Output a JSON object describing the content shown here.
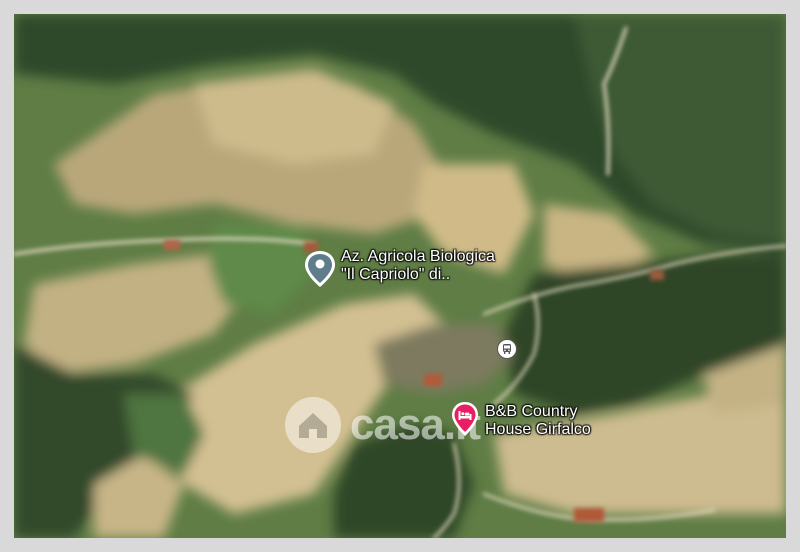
{
  "map": {
    "view": "satellite-3d",
    "watermark": "casa.it",
    "pois": [
      {
        "name_line1": "Az. Agricola Biologica",
        "name_line2": "\"Il Capriolo\" di..",
        "icon": "location-pin-icon",
        "color": "#607d8b"
      },
      {
        "name_line1": "B&B Country",
        "name_line2": "House Girfalco",
        "icon": "hotel-bed-icon",
        "color": "#e91e63"
      }
    ],
    "transit_icon": "bus-stop-icon"
  }
}
